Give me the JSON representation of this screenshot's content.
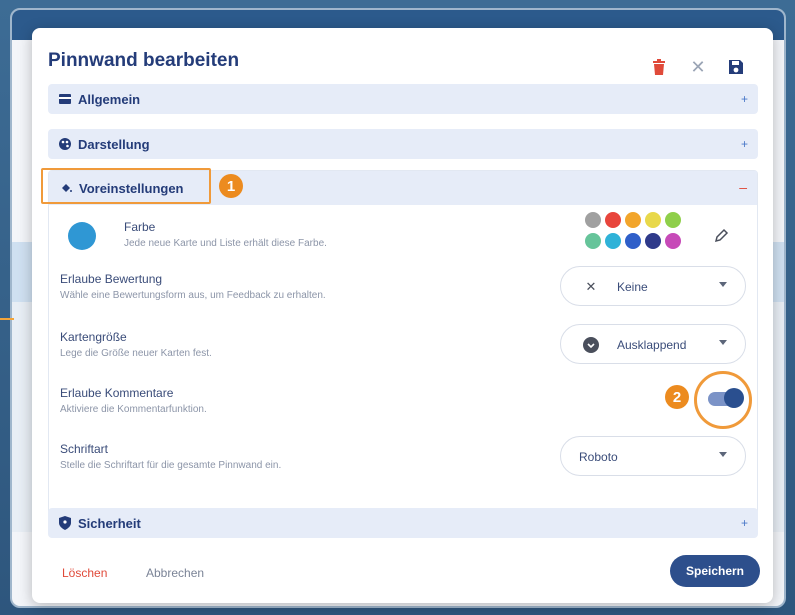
{
  "dialog": {
    "title": "Pinnwand bearbeiten",
    "icons": [
      "trash-icon",
      "close-icon",
      "save-icon"
    ]
  },
  "sections": {
    "allgemein": "Allgemein",
    "darstellung": "Darstellung",
    "voreinstellungen": "Voreinstellungen",
    "sicherheit": "Sicherheit",
    "plus": "+",
    "minus": "–"
  },
  "badges": {
    "one": "1",
    "two": "2"
  },
  "settings": {
    "farbe": {
      "label": "Farbe",
      "desc": "Jede neue Karte und Liste erhält diese Farbe.",
      "selected_color": "#2f97d4"
    },
    "bewertung": {
      "label": "Erlaube Bewertung",
      "desc": "Wähle eine Bewertungsform aus, um Feedback zu erhalten.",
      "value": "Keine"
    },
    "kartengroesse": {
      "label": "Kartengröße",
      "desc": "Lege die Größe neuer Karten fest.",
      "value": "Ausklappend"
    },
    "kommentare": {
      "label": "Erlaube Kommentare",
      "desc": "Aktiviere die Kommentarfunktion.",
      "enabled": true
    },
    "schriftart": {
      "label": "Schriftart",
      "desc": "Stelle die Schriftart für die gesamte Pinnwand ein.",
      "value": "Roboto"
    }
  },
  "palette": [
    "#a0a0a0",
    "#e8453c",
    "#f2a52b",
    "#e8d84a",
    "#8fcf4a",
    "#66c49a",
    "#2fb2d8",
    "#2f5fc9",
    "#2f3a8a",
    "#c74ab8"
  ],
  "footer": {
    "delete": "Löschen",
    "cancel": "Abbrechen",
    "save": "Speichern"
  },
  "colors": {
    "accent": "#243c79",
    "highlight": "#f09a3a",
    "danger": "#e04a3a"
  }
}
